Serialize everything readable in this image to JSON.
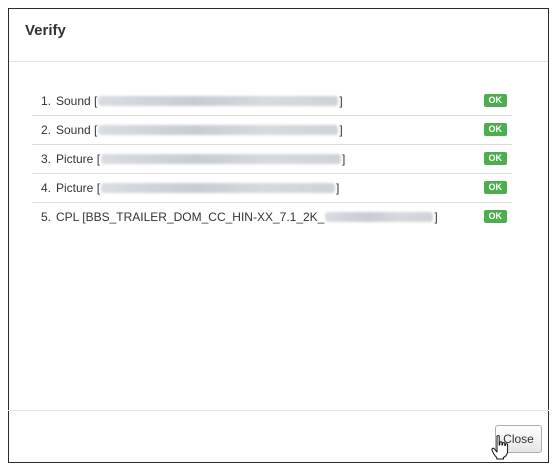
{
  "dialog": {
    "title": "Verify",
    "close_label": "Close"
  },
  "items": [
    {
      "index": "1.",
      "name": "Sound",
      "open": "[",
      "prefix": "",
      "close": "]",
      "status": "OK"
    },
    {
      "index": "2.",
      "name": "Sound",
      "open": "[",
      "prefix": "",
      "close": "]",
      "status": "OK"
    },
    {
      "index": "3.",
      "name": "Picture",
      "open": "[",
      "prefix": "",
      "close": "]",
      "status": "OK"
    },
    {
      "index": "4.",
      "name": "Picture",
      "open": "[",
      "prefix": "",
      "close": "]",
      "status": "OK"
    },
    {
      "index": "5.",
      "name": "CPL",
      "open": "[",
      "prefix": "BBS_TRAILER_DOM_CC_HIN-XX_7.1_2K_",
      "close": "]",
      "status": "OK"
    }
  ],
  "colors": {
    "ok_badge": "#4cae4c",
    "border": "#2b2b2b"
  },
  "icons": {
    "cursor": "hand-pointer-icon"
  }
}
